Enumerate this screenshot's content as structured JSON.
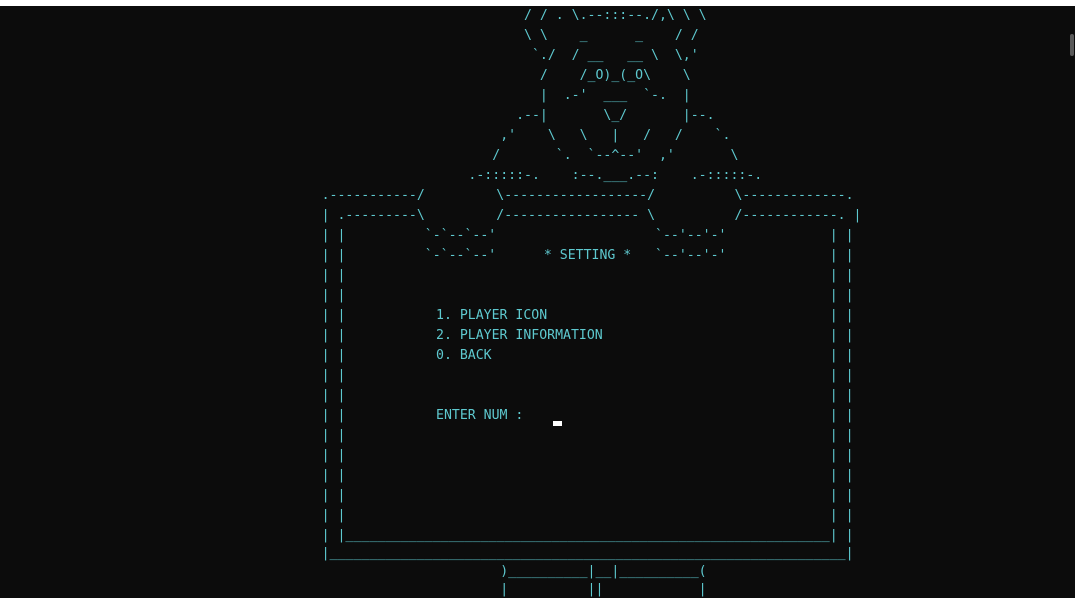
{
  "colors": {
    "background": "#0c0c0c",
    "text": "#5ec9cf",
    "cursor": "#ffffff"
  },
  "art": {
    "lines": [
      "                                                                  / / . \\.--:::--./,\\ \\ \\",
      "                                                                  \\ \\    _      _    / /",
      "                                                                   `./  / __   __ \\  \\,'",
      "                                                                    /    /_O)_(_O\\    \\",
      "                                                                    |  .-'  ___  `-.  |",
      "                                                                 .--|       \\_/       |--.",
      "                                                               ,'    \\   \\   |   /   /    `.",
      "                                                              /       `.  `--^--'  ,'       \\",
      "                                                           .-:::::-.    :--.___.--:    .-:::::-.",
      "                                        .-----------/         \\------------------/          \\-------------.",
      "                                        | .---------\\         /----------------- \\          /------------. |",
      "                                        | |          `-`--`--'                    `--'--'-'             | |",
      "                                        | |          `-`--`--'      * SETTING *   `--'--'-'             | |",
      "                                        | |                                                             | |",
      "                                        | |                                                             | |",
      "                                        | |                                                             | |",
      "                                        | |                                                             | |",
      "                                        | |                                                             | |",
      "                                        | |                                                             | |",
      "                                        | |                                                             | |",
      "                                        | |                                                             | |",
      "                                        | |                                                             | |",
      "                                        | |                                                             | |",
      "                                        | |                                                             | |",
      "                                        | |                                                             | |",
      "                                        | |                                                             | |",
      "                                        | |_____________________________________________________________| |",
      "                                        |_________________________________________________________________|",
      "                                                               )__________|__|__________(",
      "                                                               |          ||            |"
    ]
  },
  "menu": {
    "items": [
      "1. PLAYER ICON",
      "2. PLAYER INFORMATION",
      "0. BACK"
    ],
    "prompt": "ENTER NUM : "
  }
}
